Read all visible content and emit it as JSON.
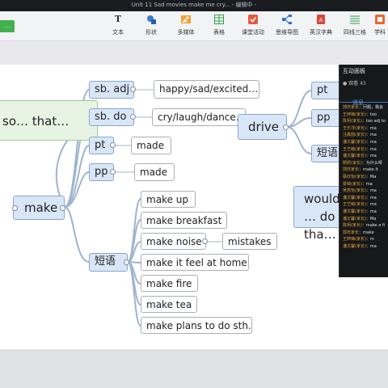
{
  "window": {
    "title": "Unit 11 Sad movies make me cry... - 编辑中 -"
  },
  "toolbar": {
    "left_button": "...",
    "items": [
      {
        "label": "文本",
        "icon": "text-icon"
      },
      {
        "label": "形状",
        "icon": "shape-icon"
      },
      {
        "label": "多媒体",
        "icon": "media-icon"
      },
      {
        "label": "表格",
        "icon": "table-icon"
      },
      {
        "label": "课堂活动",
        "icon": "activity-icon"
      },
      {
        "label": "思维导图",
        "icon": "mindmap-icon"
      },
      {
        "label": "英汉字典",
        "icon": "dictionary-icon"
      },
      {
        "label": "四线三格",
        "icon": "lines-icon"
      },
      {
        "label": "学科",
        "icon": "subject-icon"
      }
    ]
  },
  "mindmap": {
    "left_node": "so… that…",
    "make": {
      "label": "make",
      "children": [
        "sb. adj",
        "sb. do",
        "pt",
        "pp",
        "短语"
      ],
      "sb_adj_detail": "happy/sad/excited…",
      "sb_do_detail": "cry/laugh/dance…",
      "pt_detail": "made",
      "pp_detail": "made",
      "phrases": [
        "make up",
        "make  breakfast",
        "make noise",
        "make it feel at home",
        "make fire",
        "make tea",
        "make plans to do sth."
      ],
      "noise_detail": "mistakes"
    },
    "drive": {
      "label": "drive",
      "children": [
        "pt",
        "pp",
        "短语"
      ]
    },
    "right_node": "would … do tha…"
  },
  "panel": {
    "title": "互动面板",
    "viewers": "观看 43",
    "tab": "消息",
    "messages": [
      {
        "user": "郭庆家长",
        "text": "：问题，我会"
      },
      {
        "user": "王婷梅(家长)",
        "text": "：too"
      },
      {
        "user": "陈柯(家长)",
        "text": "：too adj to"
      },
      {
        "user": "王乐洋(家长)",
        "text": "：ma"
      },
      {
        "user": "汪鑫圆(家长)",
        "text": "：ma"
      },
      {
        "user": "潘文馨(家长)",
        "text": "：ma"
      },
      {
        "user": "王艺萌(家长)",
        "text": "：ma"
      },
      {
        "user": "潘文馨(家长)",
        "text": "：ma"
      },
      {
        "user": "颖妍(家长)",
        "text": "：为什么呀"
      },
      {
        "user": "郭庆家长",
        "text": "：make it"
      },
      {
        "user": "蔡欣怡(家长)",
        "text": "：Ma"
      },
      {
        "user": "梁锦(家长)",
        "text": "：ma"
      },
      {
        "user": "吴若怡(家长)",
        "text": "：ma"
      },
      {
        "user": "潘文馨(家长)",
        "text": "：ma"
      },
      {
        "user": "王艺萌(家长)",
        "text": "：ma"
      },
      {
        "user": "潘文馨(家长)",
        "text": "：ma"
      },
      {
        "user": "潘文馨(家长)",
        "text": "：Ma"
      },
      {
        "user": "陈柯(家长)",
        "text": "：make a fi"
      },
      {
        "user": "郭庆家长",
        "text": "：make"
      },
      {
        "user": "王婷梅(家长)",
        "text": "：m"
      },
      {
        "user": "潘文馨(家长)",
        "text": "：ma"
      }
    ]
  }
}
